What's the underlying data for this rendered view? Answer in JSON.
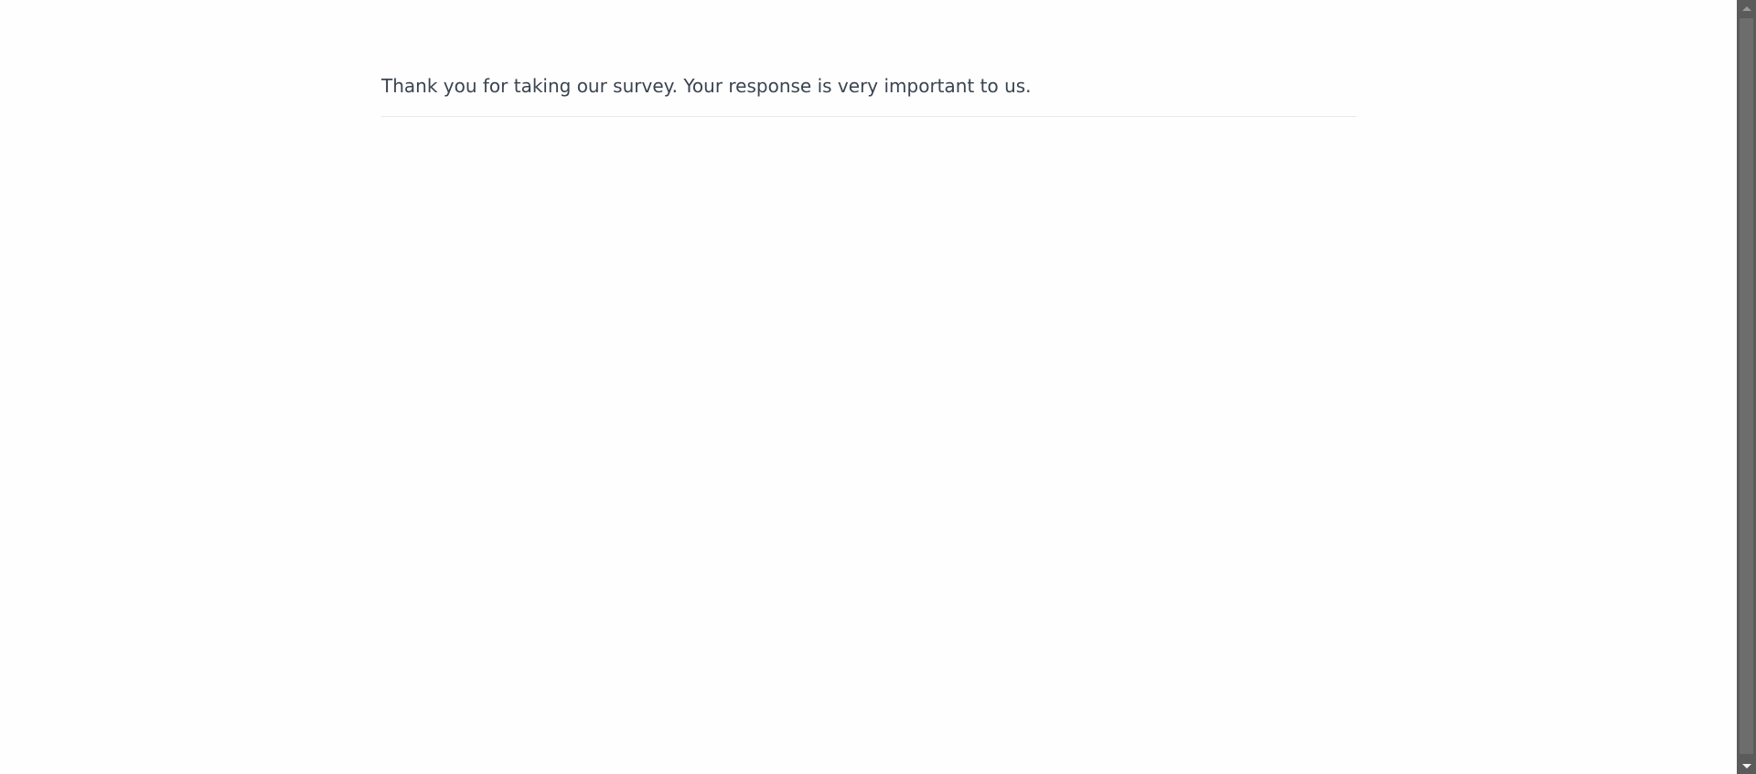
{
  "survey": {
    "completion_message": "Thank you for taking our survey. Your response is very important to us."
  }
}
